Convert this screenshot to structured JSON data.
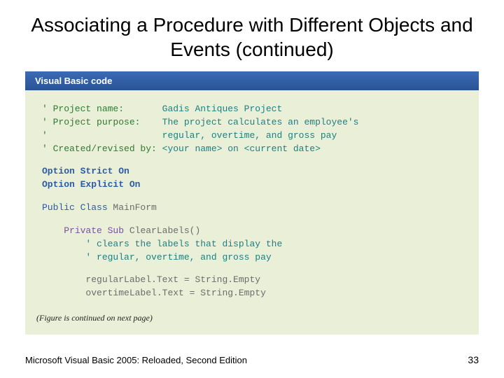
{
  "title": "Associating a Procedure with Different Objects and Events (continued)",
  "figure": {
    "header": "Visual Basic code",
    "note": "(Figure is continued on next page)"
  },
  "code": {
    "c1": {
      "l1a": "' Project name:       ",
      "l1b": "Gadis Antiques Project",
      "l2a": "' Project purpose:    ",
      "l2b": "The project calculates an employee's",
      "l3a": "'                     ",
      "l3b": "regular, overtime, and gross pay",
      "l4a": "' Created/revised by: ",
      "l4b": "<your name> on <current date>"
    },
    "c2": {
      "l1": "Option Strict On",
      "l2": "Option Explicit On"
    },
    "c3": {
      "kw": "Public Class ",
      "cls": "MainForm"
    },
    "c4": {
      "indent": "    ",
      "indent2": "        ",
      "kw": "Private Sub ",
      "name": "ClearLabels()",
      "cmt1": "' clears the labels that display the",
      "cmt2": "' regular, overtime, and gross pay"
    },
    "c5": {
      "indent": "        ",
      "l1": "regularLabel.Text = String.Empty",
      "l2": "overtimeLabel.Text = String.Empty"
    }
  },
  "footer": {
    "text": "Microsoft Visual Basic 2005: Reloaded, Second Edition",
    "page": "33"
  }
}
